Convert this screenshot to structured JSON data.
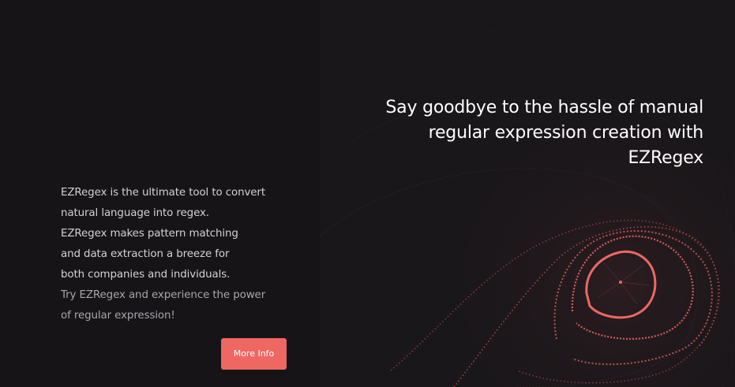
{
  "hero": {
    "headline": "Say goodbye to the hassle of manual regular expression creation with EZRegex",
    "intro_lines": [
      "EZRegex is the ultimate tool to convert",
      "natural language into regex.",
      "EZRegex makes pattern matching",
      "and data extraction a breeze for",
      "both companies and individuals.",
      "Try EZRegex and experience the power",
      "of regular expression!"
    ],
    "cta_label": "More Info"
  },
  "colors": {
    "background": "#161417",
    "accent": "#ee6762",
    "headline_text": "#ffffff",
    "body_text": "#d4d2d6"
  },
  "decoration": {
    "icon": "concentric-contour-rings-artwork"
  }
}
